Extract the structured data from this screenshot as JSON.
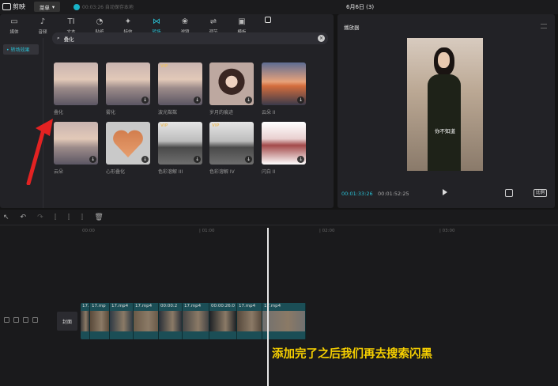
{
  "app": {
    "name": "剪映",
    "menu_label": "菜单",
    "save_status": "00:03:26 自动保存本地",
    "project_title": "6月6日 (3)"
  },
  "tools": [
    {
      "label": "媒体",
      "glyph": "▭",
      "active": false
    },
    {
      "label": "音频",
      "glyph": "♪",
      "active": false
    },
    {
      "label": "文本",
      "glyph": "TI",
      "active": false
    },
    {
      "label": "贴纸",
      "glyph": "◔",
      "active": false
    },
    {
      "label": "特效",
      "glyph": "✦",
      "active": false
    },
    {
      "label": "转场",
      "glyph": "⋈",
      "active": true
    },
    {
      "label": "滤镜",
      "glyph": "❀",
      "active": false
    },
    {
      "label": "调节",
      "glyph": "⇌",
      "active": false
    },
    {
      "label": "模板",
      "glyph": "▣",
      "active": false
    }
  ],
  "sidebar": {
    "items": [
      {
        "label": "• 转场效果"
      }
    ]
  },
  "search": {
    "value": "叠化",
    "clear_icon": "×"
  },
  "effects": [
    {
      "label": "叠化",
      "style": "sea",
      "vip": false,
      "download": false
    },
    {
      "label": "雾化",
      "style": "sea",
      "vip": false,
      "download": true
    },
    {
      "label": "波光粼粼",
      "style": "sea",
      "vip": true,
      "download": true
    },
    {
      "label": "岁月的痕迹",
      "style": "portrait",
      "vip": false,
      "download": true
    },
    {
      "label": "云朵 II",
      "style": "sunset",
      "vip": false,
      "download": true
    },
    {
      "label": "云朵",
      "style": "sea",
      "vip": false,
      "download": true
    },
    {
      "label": "心形叠化",
      "style": "heart",
      "vip": false,
      "download": true
    },
    {
      "label": "色彩溶解 III",
      "style": "bw",
      "vip": true,
      "download": true
    },
    {
      "label": "色彩溶解 IV",
      "style": "bw",
      "vip": true,
      "download": true
    },
    {
      "label": "闪白 II",
      "style": "fade",
      "vip": false,
      "download": true
    }
  ],
  "player": {
    "title": "播放器",
    "subtitle": "你不知道",
    "current_time": "00:01:33:26",
    "total_time": "00:01:52:25",
    "ratio_label": "比例"
  },
  "timeline": {
    "ticks": [
      "00:00",
      "| 01:00",
      "| 02:00",
      "| 03:00"
    ],
    "cover_label": "封面",
    "clips": [
      {
        "label": "17."
      },
      {
        "label": "17.mp"
      },
      {
        "label": "17.mp4"
      },
      {
        "label": "17.mp4"
      },
      {
        "label": "00:00:2"
      },
      {
        "label": "17.mp4"
      },
      {
        "label": "00:00:26:0"
      },
      {
        "label": "17.mp4"
      },
      {
        "label": "17.mp4"
      }
    ],
    "caption": "添加完了之后我们再去搜索闪黑"
  }
}
